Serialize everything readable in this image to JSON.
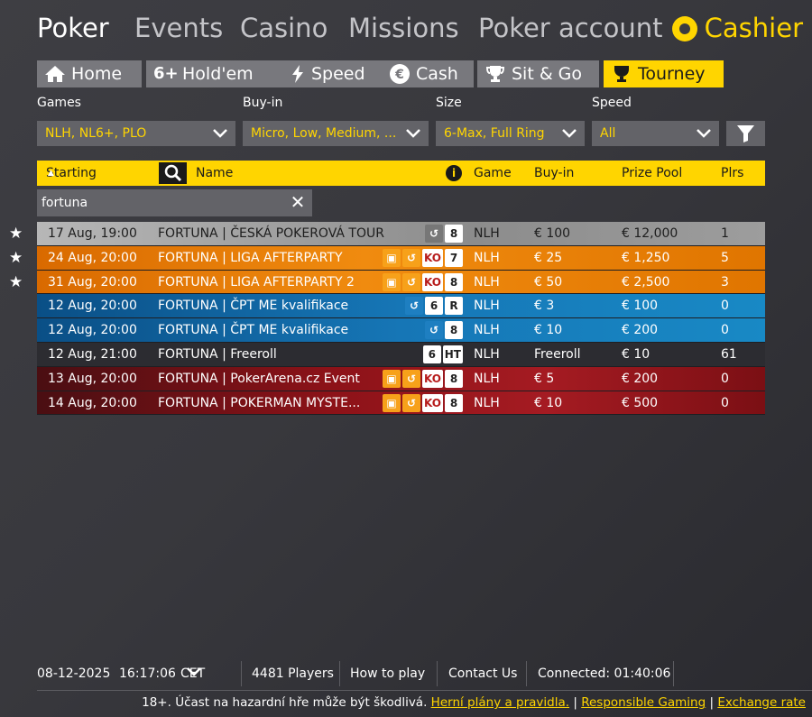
{
  "topnav": {
    "poker": "Poker",
    "events": "Events",
    "casino": "Casino",
    "missions": "Missions",
    "account": "Poker account",
    "cashier": "Cashier"
  },
  "tabs": [
    {
      "label": "Home",
      "icon": "home-icon"
    },
    {
      "label": "Hold'em",
      "icon": "6plus-icon"
    },
    {
      "label": "Speed",
      "icon": "lightning-icon"
    },
    {
      "label": "Cash",
      "icon": "euro-coin-icon"
    },
    {
      "label": "Sit & Go",
      "icon": "trophy-icon"
    },
    {
      "label": "Tourney",
      "icon": "cup-icon"
    }
  ],
  "filters": {
    "games": {
      "label": "Games",
      "value": "NLH, NL6+, PLO"
    },
    "buyin": {
      "label": "Buy-in",
      "value": "Micro, Low, Medium, ..."
    },
    "size": {
      "label": "Size",
      "value": "6-Max, Full Ring"
    },
    "speed": {
      "label": "Speed",
      "value": "All"
    }
  },
  "table": {
    "headers": {
      "starting": "Starting",
      "name": "Name",
      "game": "Game",
      "buyin": "Buy-in",
      "prize": "Prize Pool",
      "players": "Plrs"
    },
    "search": "fortuna",
    "rows": [
      {
        "date": "17 Aug, 19:00",
        "name": "FORTUNA | ČESKÁ POKEROVÁ TOUR",
        "badges": [
          "↺",
          "8"
        ],
        "game": "NLH",
        "buyin": "€ 100",
        "prize": "€ 12,000",
        "plrs": "1",
        "style": "grey",
        "starred": true
      },
      {
        "date": "24 Aug, 20:00",
        "name": "FORTUNA | LIGA AFTERPARTY",
        "badges": [
          "bag",
          "↺",
          "KO",
          "7"
        ],
        "game": "NLH",
        "buyin": "€ 25",
        "prize": "€ 1,250",
        "plrs": "5",
        "style": "orange",
        "starred": true
      },
      {
        "date": "31 Aug, 20:00",
        "name": "FORTUNA | LIGA AFTERPARTY 2",
        "badges": [
          "bag",
          "↺",
          "KO",
          "8"
        ],
        "game": "NLH",
        "buyin": "€ 50",
        "prize": "€ 2,500",
        "plrs": "3",
        "style": "orange",
        "starred": true
      },
      {
        "date": "12 Aug, 20:00",
        "name": "FORTUNA | ČPT ME kvalifikace",
        "badges": [
          "↺",
          "6",
          "R"
        ],
        "game": "NLH",
        "buyin": "€ 3",
        "prize": "€ 100",
        "plrs": "0",
        "style": "blue",
        "starred": false
      },
      {
        "date": "12 Aug, 20:00",
        "name": "FORTUNA | ČPT ME kvalifikace",
        "badges": [
          "↺",
          "8"
        ],
        "game": "NLH",
        "buyin": "€ 10",
        "prize": "€ 200",
        "plrs": "0",
        "style": "blue",
        "starred": false
      },
      {
        "date": "12 Aug, 21:00",
        "name": "FORTUNA | Freeroll",
        "badges": [
          "6",
          "HT"
        ],
        "game": "NLH",
        "buyin": "Freeroll",
        "prize": "€ 10",
        "plrs": "61",
        "style": "dark",
        "starred": false
      },
      {
        "date": "13 Aug, 20:00",
        "name": "FORTUNA | PokerArena.cz Event",
        "badges": [
          "bag",
          "↺",
          "KO",
          "8"
        ],
        "game": "NLH",
        "buyin": "€ 5",
        "prize": "€ 200",
        "plrs": "0",
        "style": "red",
        "starred": false
      },
      {
        "date": "14 Aug, 20:00",
        "name": "FORTUNA | POKERMAN MYSTE...",
        "badges": [
          "bag",
          "↺",
          "KO",
          "8"
        ],
        "game": "NLH",
        "buyin": "€ 10",
        "prize": "€ 500",
        "plrs": "0",
        "style": "red",
        "starred": false
      }
    ]
  },
  "footer": {
    "date": "08-12-2025",
    "time": "16:17:06",
    "tz": "CET",
    "players": "4481 Players",
    "howto": "How to play",
    "contact": "Contact Us",
    "connected": "Connected: 01:40:06"
  },
  "legal": {
    "text": "18+. Účast na hazardní hře může být škodlivá.",
    "link1": "Herní plány a pravidla.",
    "link2": "Responsible Gaming",
    "link3": "Exchange rate"
  }
}
